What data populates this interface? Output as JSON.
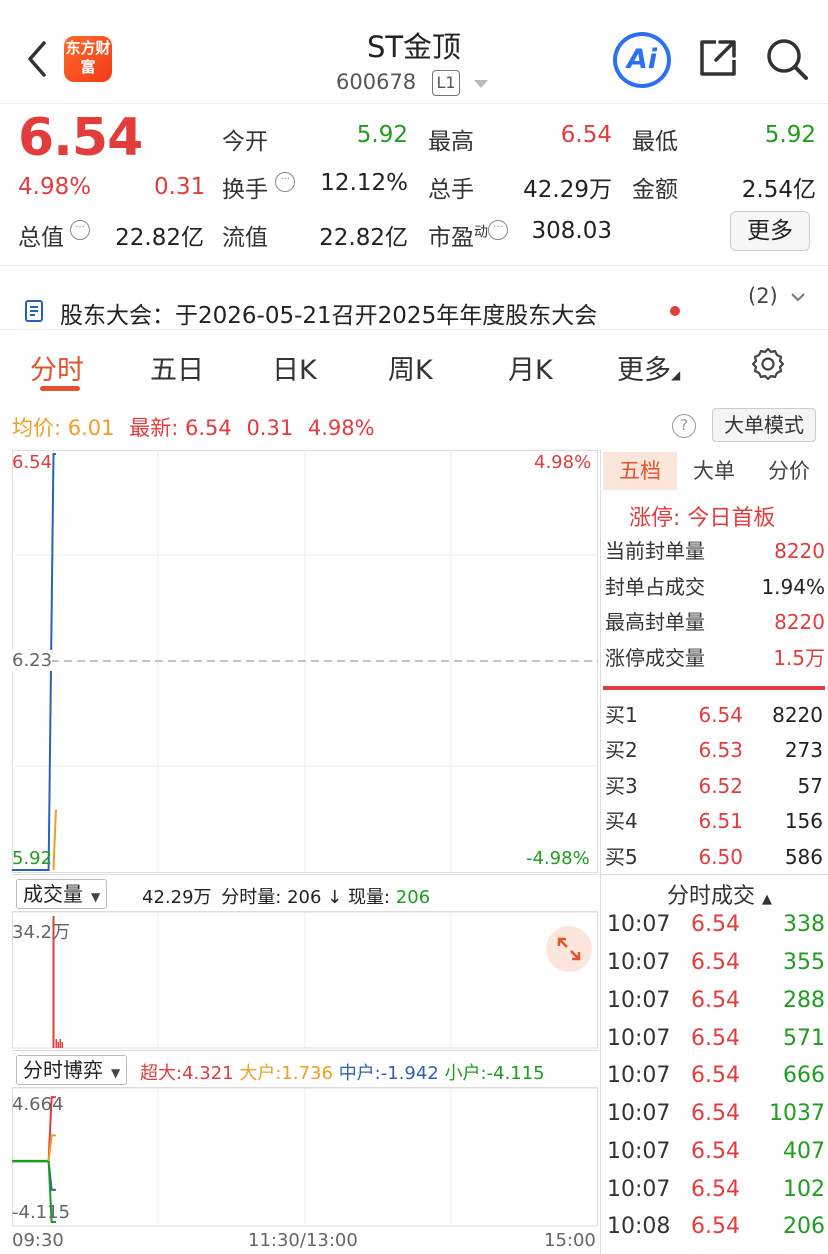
{
  "header": {
    "logo_text": "东方财富",
    "title": "ST金顶",
    "code": "600678",
    "level": "L1",
    "ai_label": "Ai"
  },
  "quote": {
    "price": "6.54",
    "change_pct": "4.98%",
    "change": "0.31",
    "open_label": "今开",
    "open": "5.92",
    "high_label": "最高",
    "high": "6.54",
    "low_label": "最低",
    "low": "5.92",
    "turnover_label": "换手",
    "turnover": "12.12%",
    "volume_label": "总手",
    "volume": "42.29万",
    "amount_label": "金额",
    "amount": "2.54亿",
    "mcap_label": "总值",
    "mcap": "22.82亿",
    "float_label": "流值",
    "float": "22.82亿",
    "pe_label": "市盈",
    "pe_sup": "动",
    "pe": "308.03",
    "more": "更多"
  },
  "notice": {
    "text": "股东大会：于2026-05-21召开2025年年度股东大会",
    "count": "(2)"
  },
  "tabs": [
    "分时",
    "五日",
    "日K",
    "周K",
    "月K",
    "更多"
  ],
  "summary": {
    "avg_label": "均价:",
    "avg": "6.01",
    "latest_label": "最新:",
    "latest": "6.54",
    "chg": "0.31",
    "pct": "4.98%",
    "bigorder": "大单模式",
    "help": "?"
  },
  "chart": {
    "y_top": "6.54",
    "y_mid": "6.23",
    "y_bot": "5.92",
    "pct_top": "4.98%",
    "pct_bot": "-4.98%",
    "vol_dropdown": "成交量",
    "vol_total": "42.29万",
    "vol_minute_label": "分时量:",
    "vol_minute": "206",
    "vol_now_label": "现量:",
    "vol_now": "206",
    "vol_max": "34.2万",
    "game_dropdown": "分时博弈",
    "game": [
      {
        "label": "超大:",
        "value": "4.321",
        "color": "#e23c3c"
      },
      {
        "label": "大户:",
        "value": "1.736",
        "color": "#f0a020"
      },
      {
        "label": "中户:",
        "value": "-1.942",
        "color": "#2a62b8"
      },
      {
        "label": "小户:",
        "value": "-4.115",
        "color": "#1f9d1f"
      }
    ],
    "game_max": "4.664",
    "game_min": "-4.115",
    "time_labels": [
      "09:30",
      "11:30/13:00",
      "15:00"
    ]
  },
  "chart_data": {
    "type": "line",
    "series": [
      {
        "name": "最新",
        "x": [
          "09:30",
          "09:45",
          "09:47",
          "09:48"
        ],
        "y": [
          5.92,
          5.92,
          6.54,
          6.54
        ]
      },
      {
        "name": "均价",
        "x": [
          "09:47",
          "09:48"
        ],
        "y": [
          5.92,
          6.01
        ]
      }
    ],
    "ylim": [
      5.92,
      6.54
    ],
    "xlabel": "",
    "ylabel": ""
  },
  "right": {
    "tabs": [
      "五档",
      "大单",
      "分价"
    ],
    "limit_up_label": "涨停:",
    "limit_up_value": "今日首板",
    "stats": [
      {
        "label": "当前封单量",
        "value": "8220",
        "red": true
      },
      {
        "label": "封单占成交",
        "value": "1.94%",
        "red": false
      },
      {
        "label": "最高封单量",
        "value": "8220",
        "red": true
      },
      {
        "label": "涨停成交量",
        "value": "1.5万",
        "red": true
      }
    ],
    "orderbook": [
      {
        "label": "买1",
        "price": "6.54",
        "qty": "8220"
      },
      {
        "label": "买2",
        "price": "6.53",
        "qty": "273"
      },
      {
        "label": "买3",
        "price": "6.52",
        "qty": "57"
      },
      {
        "label": "买4",
        "price": "6.51",
        "qty": "156"
      },
      {
        "label": "买5",
        "price": "6.50",
        "qty": "586"
      }
    ],
    "trades_title": "分时成交",
    "trades": [
      {
        "time": "10:07",
        "price": "6.54",
        "qty": "338"
      },
      {
        "time": "10:07",
        "price": "6.54",
        "qty": "355"
      },
      {
        "time": "10:07",
        "price": "6.54",
        "qty": "288"
      },
      {
        "time": "10:07",
        "price": "6.54",
        "qty": "571"
      },
      {
        "time": "10:07",
        "price": "6.54",
        "qty": "666"
      },
      {
        "time": "10:07",
        "price": "6.54",
        "qty": "1037"
      },
      {
        "time": "10:07",
        "price": "6.54",
        "qty": "407"
      },
      {
        "time": "10:07",
        "price": "6.54",
        "qty": "102"
      },
      {
        "time": "10:08",
        "price": "6.54",
        "qty": "206"
      }
    ]
  }
}
